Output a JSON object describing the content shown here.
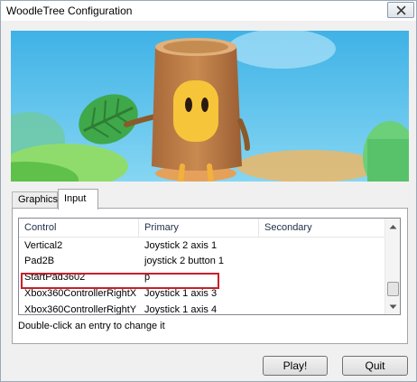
{
  "window": {
    "title": "WoodleTree Configuration"
  },
  "tabs": [
    {
      "label": "Graphics"
    },
    {
      "label": "Input"
    }
  ],
  "controls_list": {
    "columns": [
      "Control",
      "Primary",
      "Secondary"
    ],
    "rows": [
      {
        "control": "Vertical2",
        "primary": "Joystick 2 axis 1",
        "secondary": ""
      },
      {
        "control": "Pad2B",
        "primary": "joystick 2 button 1",
        "secondary": ""
      },
      {
        "control": "StartPad3602",
        "primary": "p",
        "secondary": "",
        "highlighted": true
      },
      {
        "control": "Xbox360ControllerRightX",
        "primary": "Joystick 1 axis 3",
        "secondary": ""
      },
      {
        "control": "Xbox360ControllerRightY",
        "primary": "Joystick 1 axis 4",
        "secondary": ""
      }
    ],
    "highlight_color": "#c8202a"
  },
  "hint": "Double-click an entry to change it",
  "buttons": {
    "play": "Play!",
    "quit": "Quit"
  }
}
